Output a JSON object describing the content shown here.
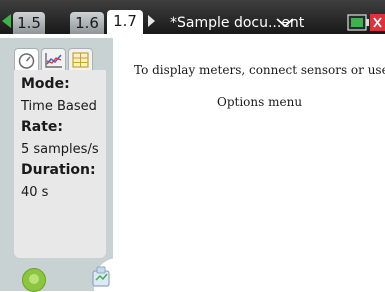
{
  "tabs": [
    {
      "label": "1.5"
    },
    {
      "label": "1.6"
    },
    {
      "label": "1.7",
      "active": true
    }
  ],
  "document": {
    "title": "*Sample docu...ent"
  },
  "sidebar": {
    "icons": [
      "meter-icon",
      "graph-icon",
      "table-icon"
    ],
    "fields": [
      {
        "label": "Mode:",
        "value": "Time Based"
      },
      {
        "label": "Rate:",
        "value": "5 samples/s"
      },
      {
        "label": "Duration:",
        "value": "40 s"
      }
    ]
  },
  "content": {
    "message": "To display meters, connect sensors or use",
    "options_menu": "Options menu"
  },
  "colors": {
    "accent_green": "#3ab54a",
    "close_red": "#e0303a",
    "sidebar_bg": "#c9d2d2",
    "play_green": "#8cc63f"
  },
  "icons": {
    "nav_left": "left-arrow-icon",
    "nav_right": "right-arrow-icon",
    "chevron": "chevron-down-icon",
    "battery": "battery-icon",
    "close": "close-icon",
    "play": "play-icon",
    "collect": "data-collect-icon"
  }
}
